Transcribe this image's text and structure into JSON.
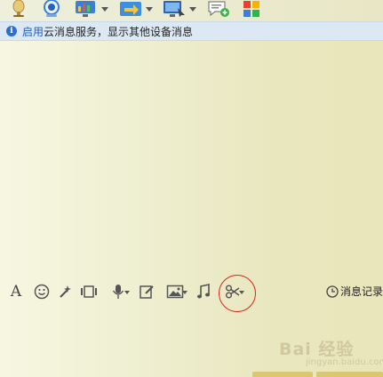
{
  "toolbar_top": {
    "icons": [
      "microphone-icon",
      "webcam-icon",
      "screen-share-icon",
      "file-transfer-icon",
      "remote-desktop-icon",
      "new-chat-icon",
      "apps-icon"
    ]
  },
  "notice": {
    "link": "启用",
    "text": "云消息服务，显示其他设备消息"
  },
  "input_toolbar": {
    "icons": [
      "font-icon",
      "emoji-icon",
      "magic-icon",
      "screenshot-frame-icon",
      "voice-icon",
      "edit-icon",
      "image-icon",
      "music-icon",
      "scissors-icon"
    ],
    "history_label": "消息记录"
  },
  "watermark": {
    "text": "Bai 经验",
    "sub": "jingyan.baidu.com"
  },
  "colors": {
    "notice_bg": "#dce9f5",
    "link": "#1a5fbf",
    "annotation": "#d9251d",
    "send_button": "#d8c872"
  }
}
